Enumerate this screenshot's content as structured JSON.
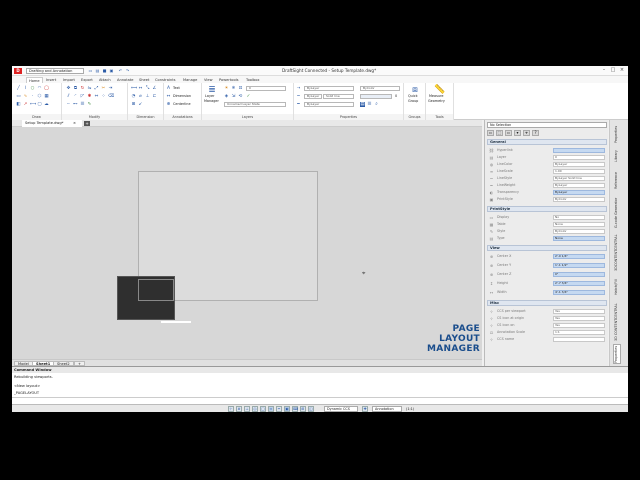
{
  "titlebar": {
    "workspace": "Drafting and Annotation",
    "window_title": "DraftSight Connected - Setup Template.dwg*",
    "quick_access_icons": [
      "new-icon",
      "open-icon",
      "save-icon",
      "print-icon",
      "undo-icon",
      "redo-icon"
    ]
  },
  "ribbon_tabs": [
    "Home",
    "Insert",
    "Import",
    "Export",
    "Attach",
    "Annotate",
    "Sheet",
    "Constraints",
    "Manage",
    "View",
    "Powertools",
    "Toolbox"
  ],
  "ribbon": {
    "groups": {
      "draw": "Draw",
      "modify": "Modify",
      "dimension": "Dimension",
      "annotations": "Annotations",
      "layers": "Layers",
      "properties": "Properties",
      "groups": "Groups",
      "tools": "Tools"
    },
    "annotations": {
      "text": "Text",
      "dimension": "Dimension",
      "centerline": "Centerline"
    },
    "layers": {
      "manager_line1": "Layer",
      "manager_line2": "Manager",
      "layer_state": "Unnamed Layer State",
      "current_layer": "0"
    },
    "properties": {
      "color": "ByLayer",
      "linestyle": "ByLayer",
      "lineweight": "ByLayer",
      "solid": "Solid line",
      "color2": "ByColor",
      "transparency": "0"
    },
    "groups_btn": {
      "line1": "Quick",
      "line2": "Group"
    },
    "tools_btn": {
      "line1": "Measure",
      "line2": "Geometry"
    }
  },
  "doc_tab": {
    "label": "Setup Template.dwg*",
    "close": "×",
    "add": "+"
  },
  "canvas": {
    "promo_line1": "PAGE",
    "promo_line2": "LAYOUT",
    "promo_line3": "MANAGER"
  },
  "sheet_tabs": [
    "Model",
    "Sheet1",
    "Sheet2",
    "+"
  ],
  "properties_panel": {
    "selection": "No Selection",
    "sections": {
      "general": "General",
      "print_style": "PrintStyle",
      "view": "View",
      "misc": "Misc"
    },
    "general_rows": [
      {
        "label": "Hyperlink",
        "value": ""
      },
      {
        "label": "Layer",
        "value": "0"
      },
      {
        "label": "LineColor",
        "value": "ByLayer"
      },
      {
        "label": "LineScale",
        "value": "1.00"
      },
      {
        "label": "LineStyle",
        "value": "ByLayer    Solid line"
      },
      {
        "label": "LineWeight",
        "value": "ByLayer"
      },
      {
        "label": "Transparency",
        "value": "ByLayer"
      },
      {
        "label": "PrintStyle",
        "value": "ByColor"
      }
    ],
    "print_rows": [
      {
        "label": "Display",
        "value": "No"
      },
      {
        "label": "Table",
        "value": "None"
      },
      {
        "label": "Style",
        "value": "ByColor"
      },
      {
        "label": "Type",
        "value": "None"
      }
    ],
    "view_rows": [
      {
        "label": "Center X",
        "value": "2'-0 1/4\""
      },
      {
        "label": "Center Y",
        "value": "1'-1 1/2\""
      },
      {
        "label": "Center Z",
        "value": "0\""
      },
      {
        "label": "Height",
        "value": "2'-7 3/4\""
      },
      {
        "label": "Width",
        "value": "4'-1 3/4\""
      }
    ],
    "misc_rows": [
      {
        "label": "CCS per viewport",
        "value": "Yes"
      },
      {
        "label": "CS icon at origin",
        "value": "Yes"
      },
      {
        "label": "CS icon on",
        "value": "Yes"
      },
      {
        "label": "Annotation Scale",
        "value": "1:1"
      },
      {
        "label": "CCS name",
        "value": ""
      }
    ]
  },
  "side_tabs": [
    "Properties",
    "Library",
    "Reference",
    "G-code Generator",
    "3DCONTENTCENTRAL",
    "Hatch/Fill",
    "3D CONTENTCENTRAL",
    "Properties"
  ],
  "command_window": {
    "title": "Command Window",
    "lines": [
      "Rebuilding viewports.",
      "<New layout>",
      "_PAGELAYOUT"
    ],
    "input": ""
  },
  "statusbar": {
    "annotation_scale_label": "Dynamic CCS",
    "annotation": "Annotation",
    "scale": "(1:1)"
  }
}
